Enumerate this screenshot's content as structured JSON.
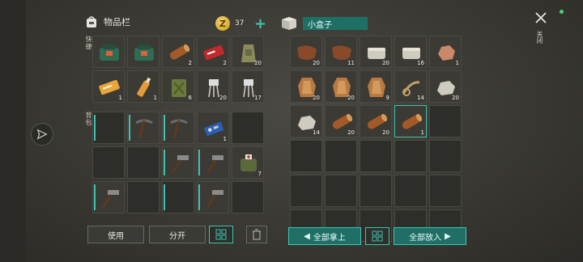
{
  "inventory": {
    "title": "物品栏",
    "coins": "37",
    "add_label": "+",
    "quick_label": "快捷",
    "backpack_label": "背包"
  },
  "container": {
    "name": "小盒子"
  },
  "close_label": "关闭",
  "quick_slots": [
    {
      "icon": "green-bag-icon",
      "count": "",
      "name": "green-bag"
    },
    {
      "icon": "green-bag-icon",
      "count": "",
      "name": "green-bag"
    },
    {
      "icon": "log-icon",
      "count": "2",
      "name": "log"
    },
    {
      "icon": "red-ticket-icon",
      "count": "2",
      "name": "red-ticket"
    },
    {
      "icon": "sack-icon",
      "count": "20",
      "name": "sack"
    },
    {
      "icon": "ticket-icon",
      "count": "1",
      "name": "ticket"
    },
    {
      "icon": "bottle-icon",
      "count": "1",
      "name": "bottle"
    },
    {
      "icon": "jerrycan-icon",
      "count": "6",
      "name": "jerrycan"
    },
    {
      "icon": "electronic-part-icon",
      "count": "20",
      "name": "electronic-part"
    },
    {
      "icon": "electronic-part-icon",
      "count": "17",
      "name": "electronic-part"
    }
  ],
  "backpack_slots": [
    {
      "icon": "",
      "count": "",
      "dura": true
    },
    {
      "icon": "pickaxe-icon",
      "count": "",
      "dura": true
    },
    {
      "icon": "pickaxe-icon",
      "count": "",
      "dura": true
    },
    {
      "icon": "circuit-board-icon",
      "count": "1",
      "dura": false
    },
    {
      "icon": "",
      "count": "",
      "dura": false
    },
    {
      "icon": "",
      "count": "",
      "dura": false
    },
    {
      "icon": "",
      "count": "",
      "dura": false
    },
    {
      "icon": "hammer-icon",
      "count": "",
      "dura": true
    },
    {
      "icon": "hammer-icon",
      "count": "",
      "dura": true
    },
    {
      "icon": "medkit-icon",
      "count": "7",
      "dura": false
    },
    {
      "icon": "hammer-icon",
      "count": "",
      "dura": true
    },
    {
      "icon": "",
      "count": "",
      "dura": false
    },
    {
      "icon": "",
      "count": "",
      "dura": true
    },
    {
      "icon": "hammer-icon",
      "count": "",
      "dura": true
    },
    {
      "icon": "",
      "count": "",
      "dura": false
    }
  ],
  "box_slots": [
    {
      "icon": "leather-icon",
      "count": "20"
    },
    {
      "icon": "leather-icon",
      "count": "11"
    },
    {
      "icon": "stone-block-icon",
      "count": "20"
    },
    {
      "icon": "stone-block-icon",
      "count": "16"
    },
    {
      "icon": "ore-icon",
      "count": "1"
    },
    {
      "icon": "hide-icon",
      "count": "20"
    },
    {
      "icon": "hide-icon",
      "count": "20"
    },
    {
      "icon": "hide-icon",
      "count": "9"
    },
    {
      "icon": "rope-icon",
      "count": "14"
    },
    {
      "icon": "stone-icon",
      "count": "20"
    },
    {
      "icon": "stone-icon",
      "count": "14"
    },
    {
      "icon": "log-icon",
      "count": "20"
    },
    {
      "icon": "log-icon",
      "count": "20"
    },
    {
      "icon": "log-icon",
      "count": "1"
    },
    {
      "icon": "",
      "count": ""
    },
    {
      "icon": "",
      "count": ""
    },
    {
      "icon": "",
      "count": ""
    },
    {
      "icon": "",
      "count": ""
    },
    {
      "icon": "",
      "count": ""
    },
    {
      "icon": "",
      "count": ""
    },
    {
      "icon": "",
      "count": ""
    },
    {
      "icon": "",
      "count": ""
    },
    {
      "icon": "",
      "count": ""
    },
    {
      "icon": "",
      "count": ""
    },
    {
      "icon": "",
      "count": ""
    },
    {
      "icon": "",
      "count": ""
    },
    {
      "icon": "",
      "count": ""
    },
    {
      "icon": "",
      "count": ""
    },
    {
      "icon": "",
      "count": ""
    },
    {
      "icon": "",
      "count": ""
    }
  ],
  "buttons": {
    "use": "使用",
    "split": "分开",
    "take_all": "全部拿上",
    "put_all": "全部放入"
  },
  "colors": {
    "accent": "#3fc3b0",
    "accent_dark": "#1f6f66",
    "background": "#3a3934"
  }
}
